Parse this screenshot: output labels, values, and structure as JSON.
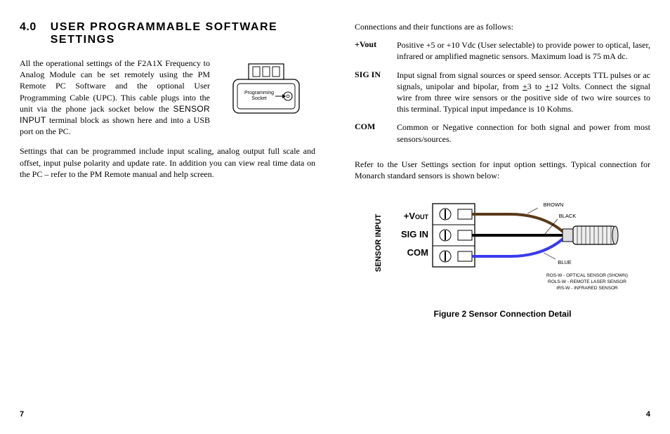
{
  "left": {
    "section_num": "4.0",
    "section_title": "USER PROGRAMMABLE SOFTWARE SETTINGS",
    "intro_a": "All the operational settings of the F2A1X Frequency to Analog Module can be set remotely using the PM Remote PC Software and the optional User Programming Cable (UPC). This cable plugs into the unit via the phone jack socket below the ",
    "intro_b": "SENSOR INPUT",
    "intro_c": " terminal block as shown here and into a USB port on the PC.",
    "para2": "Settings that can be programmed include input scaling, analog output full scale and offset, input pulse polarity and update rate. In addition you can view real time data on the PC – refer to the PM Remote manual and help screen.",
    "socket_label": "Programming\nSocket",
    "page_num": "7"
  },
  "right": {
    "intro": "Connections and their functions are as follows:",
    "defs": [
      {
        "term": "+Vout",
        "desc": "Positive +5 or +10 Vdc (User selectable) to provide power to optical, laser, infrared or amplified magnetic sensors.  Maximum load is 75 mA dc."
      },
      {
        "term": "SIG IN",
        "desc_a": "Input signal from signal sources or speed sensor. Accepts TTL pulses or ac signals, unipolar and bipolar, from ",
        "desc_b": "+",
        "desc_c": "3 to ",
        "desc_d": "+",
        "desc_e": "12 Volts. Connect the signal wire from three wire sensors or the positive side of two wire sources to this terminal.  Typical input impedance is 10 Kohms."
      },
      {
        "term": "COM",
        "desc": "Common or Negative connection for both signal and power from most sensors/sources."
      }
    ],
    "para_after": "Refer to the User Settings section for input option settings. Typical connection for Monarch standard sensors is shown below:",
    "fig": {
      "side_label": "SENSOR INPUT",
      "vout": "+V",
      "vout_sub": "OUT",
      "sigin": "SIG IN",
      "com": "COM",
      "brown": "BROWN",
      "black": "BLACK",
      "blue": "BLUE",
      "note1": "ROS-W - OPTICAL SENSOR (SHOWN)",
      "note2": "ROLS-W - REMOTE LASER SENSOR",
      "note3": "IRS-W - INFRARED SENSOR",
      "caption": "Figure 2  Sensor Connection Detail"
    },
    "page_num": "4"
  }
}
